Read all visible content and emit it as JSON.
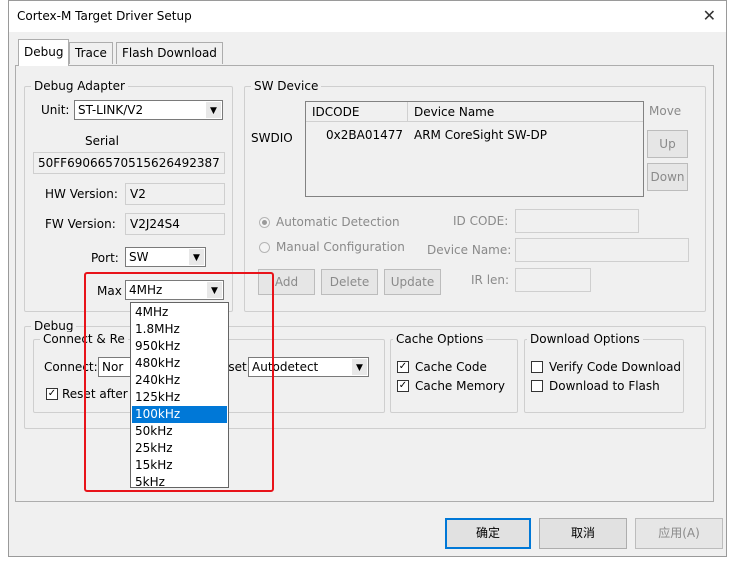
{
  "window": {
    "title": "Cortex-M Target Driver Setup"
  },
  "tabs": [
    {
      "label": "Debug",
      "active": true
    },
    {
      "label": "Trace",
      "active": false
    },
    {
      "label": "Flash Download",
      "active": false
    }
  ],
  "debug_adapter": {
    "group_label": "Debug Adapter",
    "unit_label": "Unit:",
    "unit_value": "ST-LINK/V2",
    "serial_label": "Serial",
    "serial_value": "50FF6906657051562649238​7",
    "hw_label": "HW Version:",
    "hw_value": "V2",
    "fw_label": "FW Version:",
    "fw_value": "V2J24S4",
    "port_label": "Port:",
    "port_value": "SW",
    "max_label": "Max",
    "max_value": "4MHz"
  },
  "clock_options": [
    "4MHz",
    "1.8MHz",
    "950kHz",
    "480kHz",
    "240kHz",
    "125kHz",
    "100kHz",
    "50kHz",
    "25kHz",
    "15kHz",
    "5kHz"
  ],
  "clock_highlighted": "100kHz",
  "sw_device": {
    "group_label": "SW Device",
    "swdio_label": "SWDIO",
    "columns": [
      "IDCODE",
      "Device Name"
    ],
    "rows": [
      {
        "idcode": "0x2BA01477",
        "name": "ARM CoreSight SW-DP"
      }
    ],
    "move_label": "Move",
    "up_label": "Up",
    "down_label": "Down",
    "auto_detect_label": "Automatic Detection",
    "manual_config_label": "Manual Configuration",
    "id_code_label": "ID CODE:",
    "device_name_label": "Device Name:",
    "ir_len_label": "IR len:",
    "add_label": "Add",
    "delete_label": "Delete",
    "update_label": "Update"
  },
  "debug_group": {
    "group_label": "Debug",
    "connect_reset_label": "Connect & Re",
    "connect_label": "Connect:",
    "connect_value": "Nor",
    "reset_label": "eset:",
    "reset_value": "Autodetect",
    "reset_after_label": "Reset after"
  },
  "cache_options": {
    "group_label": "Cache Options",
    "cache_code_label": "Cache Code",
    "cache_code_checked": true,
    "cache_memory_label": "Cache Memory",
    "cache_memory_checked": true
  },
  "download_options": {
    "group_label": "Download Options",
    "verify_label": "Verify Code Download",
    "verify_checked": false,
    "download_flash_label": "Download to Flash",
    "download_flash_checked": false
  },
  "footer": {
    "ok_label": "确定",
    "cancel_label": "取消",
    "apply_label": "应用(A)"
  },
  "colors": {
    "highlight": "#0078d7",
    "annotation_red": "#e8131a",
    "dialog_bg": "#f0f0f0"
  }
}
